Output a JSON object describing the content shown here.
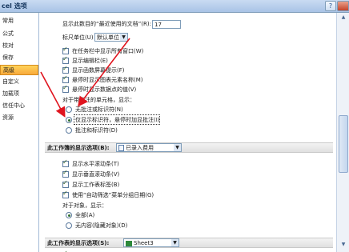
{
  "window": {
    "title": "cel 选项",
    "help": "?",
    "close": ""
  },
  "nav": {
    "items": [
      {
        "label": "常用"
      },
      {
        "label": "公式"
      },
      {
        "label": "校对"
      },
      {
        "label": "保存"
      },
      {
        "label": "高级",
        "active": true
      },
      {
        "label": "自定义"
      },
      {
        "label": "加载项"
      },
      {
        "label": "信任中心"
      },
      {
        "label": "资源"
      }
    ]
  },
  "top": {
    "recent_docs_label": "显示此数目的“最近使用的文档”(R):",
    "recent_docs_value": "17",
    "ruler_label": "标尺单位(U)",
    "ruler_value": "默认单位"
  },
  "options1": [
    {
      "label": "在任务栏中显示所有窗口(W)",
      "checked": true
    },
    {
      "label": "显示编辑栏(E)",
      "checked": true
    },
    {
      "label": "显示函数屏幕提示(F)",
      "checked": true
    },
    {
      "label": "悬停时显示图表元素名称(M)",
      "checked": true
    },
    {
      "label": "悬停时显示数据点的值(V)",
      "checked": true
    }
  ],
  "comments": {
    "heading": "对于带批注的单元格，显示：",
    "radios": [
      {
        "label": "无批注或标识符(N)",
        "checked": false
      },
      {
        "label": "仅显示标识符，悬停时加显批注(I)",
        "checked": true
      },
      {
        "label": "批注和标识符(D)",
        "checked": false
      }
    ]
  },
  "workbook_section": {
    "title": "此工作簿的显示选项(B):",
    "combo": "已录入费用",
    "checks": [
      {
        "label": "显示水平滚动条(T)",
        "checked": true
      },
      {
        "label": "显示垂直滚动条(V)",
        "checked": true
      },
      {
        "label": "显示工作表标签(B)",
        "checked": true
      },
      {
        "label": "使用“自动筛选”菜单分组日期(G)",
        "checked": true
      }
    ],
    "objects_heading": "对于对象，显示：",
    "objects_radios": [
      {
        "label": "全部(A)",
        "checked": true
      },
      {
        "label": "无内容(隐藏对象)(D)",
        "checked": false
      }
    ]
  },
  "sheet_section": {
    "title": "此工作表的显示选项(S):",
    "combo": "Sheet3"
  },
  "colors": {
    "arrow": "#e0141e",
    "active_nav": "#f8a93c"
  }
}
